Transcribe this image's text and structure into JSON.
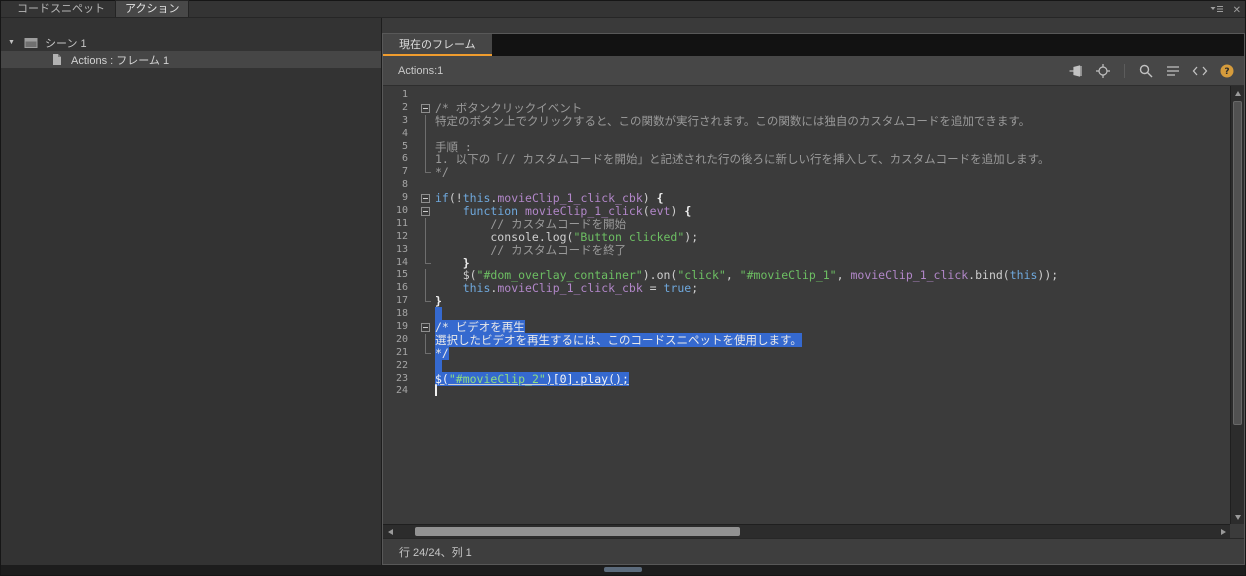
{
  "colors": {
    "accent_orange": "#ef9c2e",
    "selection_blue": "#3569cf",
    "keyword_blue": "#6fa8dc",
    "identifier_purple": "#b287c9",
    "string_green": "#6dbf63",
    "comment_gray": "#9a9a9a",
    "plain_text": "#cfcfcf",
    "help_icon_yellow": "#d69c3c"
  },
  "top_tabs": [
    {
      "label": "コードスニペット",
      "active": false
    },
    {
      "label": "アクション",
      "active": true
    }
  ],
  "left_panel": {
    "scene_label": "シーン 1",
    "frame_label": "Actions : フレーム 1"
  },
  "editor": {
    "tab_label": "現在のフレーム",
    "header_label": "Actions:1",
    "status_label": "行 24/24、列 1",
    "toolbar_icons": [
      "pin-icon",
      "target-icon",
      "search-icon",
      "format-icon",
      "code-brackets-icon",
      "help-icon"
    ]
  },
  "code": {
    "lines": [
      {
        "n": 1,
        "fold": "",
        "seg": []
      },
      {
        "n": 2,
        "fold": "box",
        "seg": [
          {
            "t": "/* ボタンクリックイベント",
            "c": "c"
          }
        ]
      },
      {
        "n": 3,
        "fold": "v",
        "seg": [
          {
            "t": "特定のボタン上でクリックすると、この関数が実行されます。この関数には独自のカスタムコードを追加できます。",
            "c": "c"
          }
        ]
      },
      {
        "n": 4,
        "fold": "v",
        "seg": []
      },
      {
        "n": 5,
        "fold": "v",
        "seg": [
          {
            "t": "手順 :",
            "c": "c"
          }
        ]
      },
      {
        "n": 6,
        "fold": "v",
        "seg": [
          {
            "t": "1. 以下の「// カスタムコードを開始」と記述された行の後ろに新しい行を挿入して、カスタムコードを追加します。",
            "c": "c"
          }
        ]
      },
      {
        "n": 7,
        "fold": "end",
        "seg": [
          {
            "t": "*/",
            "c": "c"
          }
        ]
      },
      {
        "n": 8,
        "fold": "",
        "seg": []
      },
      {
        "n": 9,
        "fold": "box",
        "seg": [
          {
            "t": "if",
            "c": "k"
          },
          {
            "t": "(!",
            "c": "p"
          },
          {
            "t": "this",
            "c": "k"
          },
          {
            "t": ".",
            "c": "p"
          },
          {
            "t": "movieClip_1_click_cbk",
            "c": "i"
          },
          {
            "t": ") ",
            "c": "p"
          },
          {
            "t": "{",
            "c": "b"
          }
        ]
      },
      {
        "n": 10,
        "fold": "box",
        "seg": [
          {
            "t": "    ",
            "c": "p"
          },
          {
            "t": "function",
            "c": "k"
          },
          {
            "t": " ",
            "c": "p"
          },
          {
            "t": "movieClip_1_click",
            "c": "i"
          },
          {
            "t": "(",
            "c": "p"
          },
          {
            "t": "evt",
            "c": "i"
          },
          {
            "t": ") ",
            "c": "p"
          },
          {
            "t": "{",
            "c": "b"
          }
        ]
      },
      {
        "n": 11,
        "fold": "v",
        "seg": [
          {
            "t": "        // カスタムコードを開始",
            "c": "c"
          }
        ]
      },
      {
        "n": 12,
        "fold": "v",
        "seg": [
          {
            "t": "        console.log(",
            "c": "p"
          },
          {
            "t": "\"Button clicked\"",
            "c": "s"
          },
          {
            "t": ");",
            "c": "p"
          }
        ]
      },
      {
        "n": 13,
        "fold": "v",
        "seg": [
          {
            "t": "        // カスタムコードを終了",
            "c": "c"
          }
        ]
      },
      {
        "n": 14,
        "fold": "end",
        "seg": [
          {
            "t": "    ",
            "c": "p"
          },
          {
            "t": "}",
            "c": "b"
          }
        ]
      },
      {
        "n": 15,
        "fold": "v",
        "seg": [
          {
            "t": "    $(",
            "c": "p"
          },
          {
            "t": "\"#dom_overlay_container\"",
            "c": "s"
          },
          {
            "t": ").on(",
            "c": "p"
          },
          {
            "t": "\"click\"",
            "c": "s"
          },
          {
            "t": ", ",
            "c": "p"
          },
          {
            "t": "\"#movieClip_1\"",
            "c": "s"
          },
          {
            "t": ", ",
            "c": "p"
          },
          {
            "t": "movieClip_1_click",
            "c": "i"
          },
          {
            "t": ".bind(",
            "c": "p"
          },
          {
            "t": "this",
            "c": "k"
          },
          {
            "t": "));",
            "c": "p"
          }
        ]
      },
      {
        "n": 16,
        "fold": "v",
        "seg": [
          {
            "t": "    ",
            "c": "p"
          },
          {
            "t": "this",
            "c": "k"
          },
          {
            "t": ".",
            "c": "p"
          },
          {
            "t": "movieClip_1_click_cbk",
            "c": "i"
          },
          {
            "t": " = ",
            "c": "p"
          },
          {
            "t": "true",
            "c": "k"
          },
          {
            "t": ";",
            "c": "p"
          }
        ]
      },
      {
        "n": 17,
        "fold": "end",
        "seg": [
          {
            "t": "}",
            "c": "b"
          }
        ]
      },
      {
        "n": 18,
        "fold": "",
        "sel": true,
        "seg": []
      },
      {
        "n": 19,
        "fold": "box",
        "sel": true,
        "seg": [
          {
            "t": "/* ビデオを再生",
            "c": "c"
          }
        ]
      },
      {
        "n": 20,
        "fold": "v",
        "sel": true,
        "seg": [
          {
            "t": "選択したビデオを再生するには、このコードスニペットを使用します。",
            "c": "c"
          }
        ]
      },
      {
        "n": 21,
        "fold": "end",
        "sel": true,
        "seg": [
          {
            "t": "*/",
            "c": "c"
          }
        ]
      },
      {
        "n": 22,
        "fold": "",
        "sel": true,
        "seg": []
      },
      {
        "n": 23,
        "fold": "",
        "sel": true,
        "underline": true,
        "seg": [
          {
            "t": "$(",
            "c": "p"
          },
          {
            "t": "\"#movieClip_2\"",
            "c": "s"
          },
          {
            "t": ")[0].play();",
            "c": "p"
          }
        ]
      },
      {
        "n": 24,
        "fold": "",
        "cursor": true,
        "seg": []
      }
    ]
  }
}
